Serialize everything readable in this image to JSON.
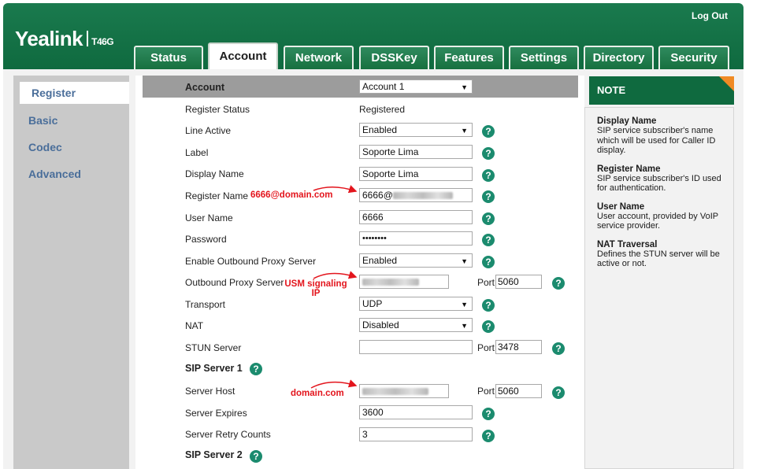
{
  "header": {
    "logo": "Yealink",
    "model": "T46G",
    "logout": "Log Out",
    "tabs": [
      "Status",
      "Account",
      "Network",
      "DSSKey",
      "Features",
      "Settings",
      "Directory",
      "Security"
    ],
    "active_tab": "Account"
  },
  "sidebar": {
    "items": [
      "Register",
      "Basic",
      "Codec",
      "Advanced"
    ],
    "active": "Register"
  },
  "form": {
    "account_label": "Account",
    "account_value": "Account 1",
    "register_status_label": "Register Status",
    "register_status_value": "Registered",
    "line_active_label": "Line Active",
    "line_active_value": "Enabled",
    "label_label": "Label",
    "label_value": "Soporte Lima",
    "display_name_label": "Display Name",
    "display_name_value": "Soporte Lima",
    "register_name_label": "Register Name",
    "register_name_value": "6666@",
    "user_name_label": "User Name",
    "user_name_value": "6666",
    "password_label": "Password",
    "password_value": "••••••••",
    "outbound_proxy_enable_label": "Enable Outbound Proxy Server",
    "outbound_proxy_enable_value": "Enabled",
    "outbound_proxy_label": "Outbound Proxy Server",
    "port_label": "Port",
    "outbound_proxy_port": "5060",
    "transport_label": "Transport",
    "transport_value": "UDP",
    "nat_label": "NAT",
    "nat_value": "Disabled",
    "stun_label": "STUN Server",
    "stun_port": "3478",
    "sip1_label": "SIP Server 1",
    "server_host_label": "Server Host",
    "server_host_port": "5060",
    "server_expires_label": "Server Expires",
    "server_expires_value": "3600",
    "retry_label": "Server Retry Counts",
    "retry_value": "3",
    "sip2_label": "SIP Server 2",
    "help_glyph": "?"
  },
  "annotations": {
    "register_name": "6666@domain.com",
    "outbound_proxy": "USM signaling IP",
    "server_host": "domain.com",
    "color": "#e3151d"
  },
  "note": {
    "title": "NOTE",
    "items": [
      {
        "title": "Display Name",
        "text": "SIP service subscriber's name which will be used for Caller ID display."
      },
      {
        "title": "Register Name",
        "text": "SIP service subscriber's ID used for authentication."
      },
      {
        "title": "User Name",
        "text": "User account, provided by VoIP service provider."
      },
      {
        "title": "NAT Traversal",
        "text": "Defines the STUN server will be active or not."
      }
    ]
  },
  "colors": {
    "brand_green": "#0f6a3f",
    "help_green": "#1b8b6e",
    "link_blue": "#4a6e9a",
    "note_corner": "#f08a24"
  }
}
